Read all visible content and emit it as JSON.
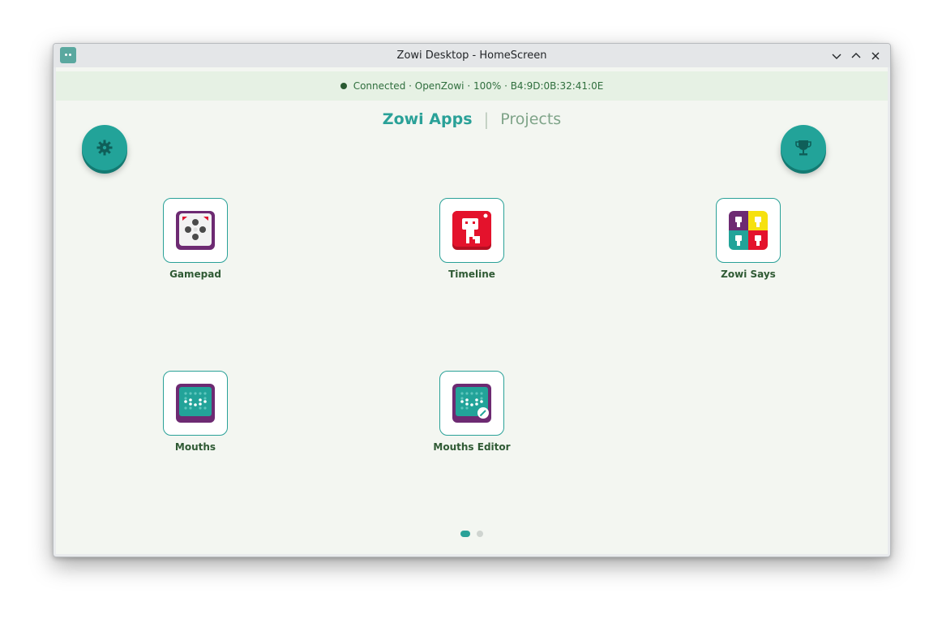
{
  "window": {
    "title": "Zowi Desktop - HomeScreen",
    "controls": [
      "minimize",
      "maximize",
      "close"
    ]
  },
  "status": {
    "text": "Connected · OpenZowi · 100% · B4:9D:0B:32:41:0E"
  },
  "tabs": {
    "active": "Zowi Apps",
    "separator": "|",
    "inactive": "Projects"
  },
  "buttons": {
    "settings_icon": "gear-icon",
    "trophy_icon": "trophy-icon"
  },
  "apps": [
    {
      "label": "Gamepad",
      "icon": "gamepad-icon"
    },
    {
      "label": "Timeline",
      "icon": "timeline-icon"
    },
    {
      "label": "Zowi Says",
      "icon": "zowi-says-icon"
    },
    {
      "label": "Mouths",
      "icon": "mouths-icon"
    },
    {
      "label": "Mouths Editor",
      "icon": "mouths-editor-icon"
    }
  ],
  "pager": {
    "pages": 2,
    "current": 1
  },
  "colors": {
    "accent": "#2aa198",
    "status_bg": "#e6f1e4",
    "label": "#2f5a34"
  }
}
